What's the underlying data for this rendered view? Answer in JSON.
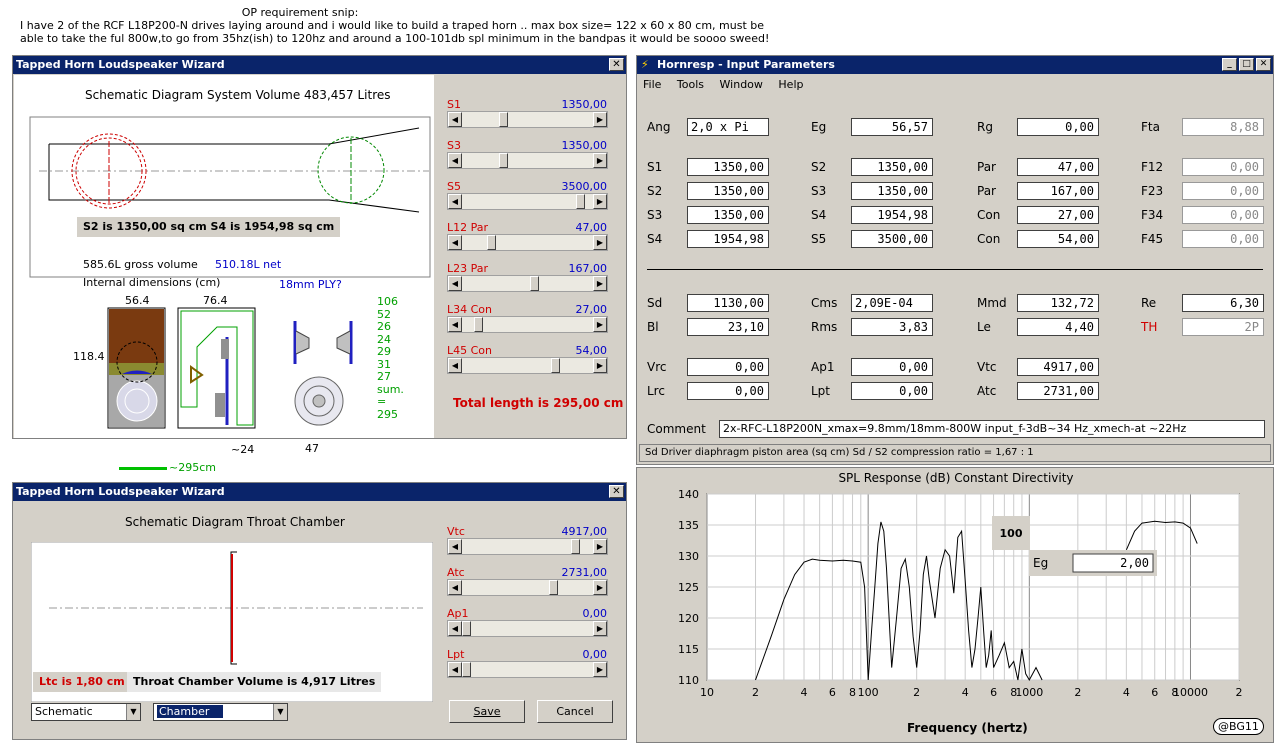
{
  "note": {
    "heading": "OP requirement snip:",
    "line1": "I have 2 of the RCF L18P200-N drives laying around and i would like to build a traped horn .. max box size= 122 x 60 x 80 cm, must be",
    "line2": "able to take the ful 800w,to go from 35hz(ish) to 120hz and around a 100-101db spl minimum in the bandpas it would be soooo sweed!"
  },
  "wizard1": {
    "title": "Tapped Horn Loudspeaker Wizard",
    "heading": "Schematic Diagram   System Volume 483,457 Litres",
    "areas": "S2 is 1350,00 sq cm    S4 is 1954,98 sq cm",
    "gross": "585.6L gross volume",
    "net": "510.18L net",
    "internal": "Internal dimensions  (cm)",
    "ply": "18mm PLY?",
    "dim_w1": "56.4",
    "dim_w2": "76.4",
    "dim_h": "118.4",
    "dim_d": "~24",
    "dim_47": "47",
    "stack": [
      "106",
      "52",
      "26",
      "24",
      "29",
      "31",
      "27",
      "sum.",
      "=",
      "295"
    ],
    "legend": "~295cm",
    "total": "Total length is 295,00 cm",
    "sliders": [
      {
        "label": "S1",
        "value": "1350,00",
        "pos": 0.3
      },
      {
        "label": "S3",
        "value": "1350,00",
        "pos": 0.3
      },
      {
        "label": "S5",
        "value": "3500,00",
        "pos": 0.92
      },
      {
        "label": "L12  Par",
        "value": "47,00",
        "pos": 0.2
      },
      {
        "label": "L23  Par",
        "value": "167,00",
        "pos": 0.55
      },
      {
        "label": "L34  Con",
        "value": "27,00",
        "pos": 0.1
      },
      {
        "label": "L45  Con",
        "value": "54,00",
        "pos": 0.72
      }
    ]
  },
  "wizard2": {
    "title": "Tapped Horn Loudspeaker Wizard",
    "heading": "Schematic Diagram   Throat Chamber",
    "ltc": "Ltc is 1,80 cm",
    "volume": "Throat Chamber Volume is 4,917 Litres",
    "sel1": "Schematic",
    "sel2": "Chamber",
    "save": "Save",
    "cancel": "Cancel",
    "sliders": [
      {
        "label": "Vtc",
        "value": "4917,00",
        "pos": 0.88
      },
      {
        "label": "Atc",
        "value": "2731,00",
        "pos": 0.7
      },
      {
        "label": "Ap1",
        "value": "0,00",
        "pos": 0.0
      },
      {
        "label": "Lpt",
        "value": "0,00",
        "pos": 0.0
      }
    ]
  },
  "hornresp": {
    "title": "Hornresp - Input Parameters",
    "menu": [
      "File",
      "Tools",
      "Window",
      "Help"
    ],
    "params": {
      "Ang": "2,0 x Pi",
      "Eg": "56,57",
      "Rg": "0,00",
      "Fta": "8,88",
      "S1a": "1350,00",
      "S2a": "1350,00",
      "Par1": "47,00",
      "F12": "0,00",
      "S2b": "1350,00",
      "S3b": "1350,00",
      "Par2": "167,00",
      "F23": "0,00",
      "S3c": "1350,00",
      "S4c": "1954,98",
      "Con1": "27,00",
      "F34": "0,00",
      "S4d": "1954,98",
      "S5d": "3500,00",
      "Con2": "54,00",
      "F45": "0,00",
      "Sd": "1130,00",
      "Cms": "2,09E-04",
      "Mmd": "132,72",
      "Re": "6,30",
      "Bl": "23,10",
      "Rms": "3,83",
      "Le": "4,40",
      "TH": "2P",
      "Vrc": "0,00",
      "Ap1": "0,00",
      "Vtc": "4917,00",
      "Lrc": "0,00",
      "Lpt": "0,00",
      "Atc": "2731,00"
    },
    "comment_label": "Comment",
    "comment": "2x-RFC-L18P200N_xmax=9.8mm/18mm-800W input_f-3dB~34 Hz_xmech-at ~22Hz",
    "status": "Sd  Driver diaphragm piston area  (sq cm)   Sd / S2 compression ratio = 1,67 : 1"
  },
  "spl": {
    "title": "SPL Response (dB)   Constant Directivity",
    "xlabel": "Frequency (hertz)",
    "inset_value": "100",
    "eg_label": "Eg",
    "eg_value": "2,00",
    "badge": "@BG11"
  },
  "chart_data": {
    "type": "line",
    "title": "SPL Response (dB)   Constant Directivity",
    "xlabel": "Frequency (hertz)",
    "ylabel": "",
    "xscale": "log",
    "xlim": [
      10,
      20000
    ],
    "ylim": [
      110,
      140
    ],
    "yticks": [
      110,
      115,
      120,
      125,
      130,
      135,
      140
    ],
    "xticklabels": [
      "10",
      "2",
      "4",
      "6",
      "8",
      "100",
      "2",
      "4",
      "6",
      "8",
      "1000",
      "2",
      "4",
      "6",
      "8",
      "10000",
      "2"
    ],
    "series": [
      {
        "x": [
          20,
          25,
          30,
          35,
          40,
          45,
          50,
          60,
          70,
          80,
          90,
          95,
          100,
          105,
          110,
          115,
          120,
          125,
          130,
          140,
          150,
          160,
          170,
          180,
          190,
          200,
          210,
          220,
          230,
          240,
          260,
          280,
          300,
          320,
          340,
          360,
          380,
          400,
          420,
          440,
          460,
          480,
          500,
          520,
          540,
          560,
          580,
          600,
          650,
          700,
          750,
          800,
          850,
          900,
          950,
          1000,
          1100,
          1200
        ],
        "values": [
          110,
          117,
          123,
          127,
          129,
          129.5,
          129.3,
          129.2,
          129.3,
          129.2,
          129,
          125,
          110,
          118,
          125,
          132,
          135.5,
          134,
          128,
          112,
          120,
          128,
          129.5,
          125,
          117,
          112,
          118,
          127,
          130,
          126,
          120,
          128,
          131,
          130,
          124,
          133,
          134,
          126,
          118,
          112,
          115,
          120,
          125,
          118,
          112,
          114,
          118,
          112,
          114,
          116,
          112,
          113,
          110,
          115,
          111,
          110,
          112,
          110
        ]
      },
      {
        "x": [
          4000,
          4500,
          5000,
          6000,
          7000,
          8000,
          9000,
          10000,
          11000
        ],
        "values": [
          131,
          134,
          135.3,
          135.6,
          135.4,
          135.5,
          135.3,
          134.5,
          132
        ]
      }
    ]
  }
}
